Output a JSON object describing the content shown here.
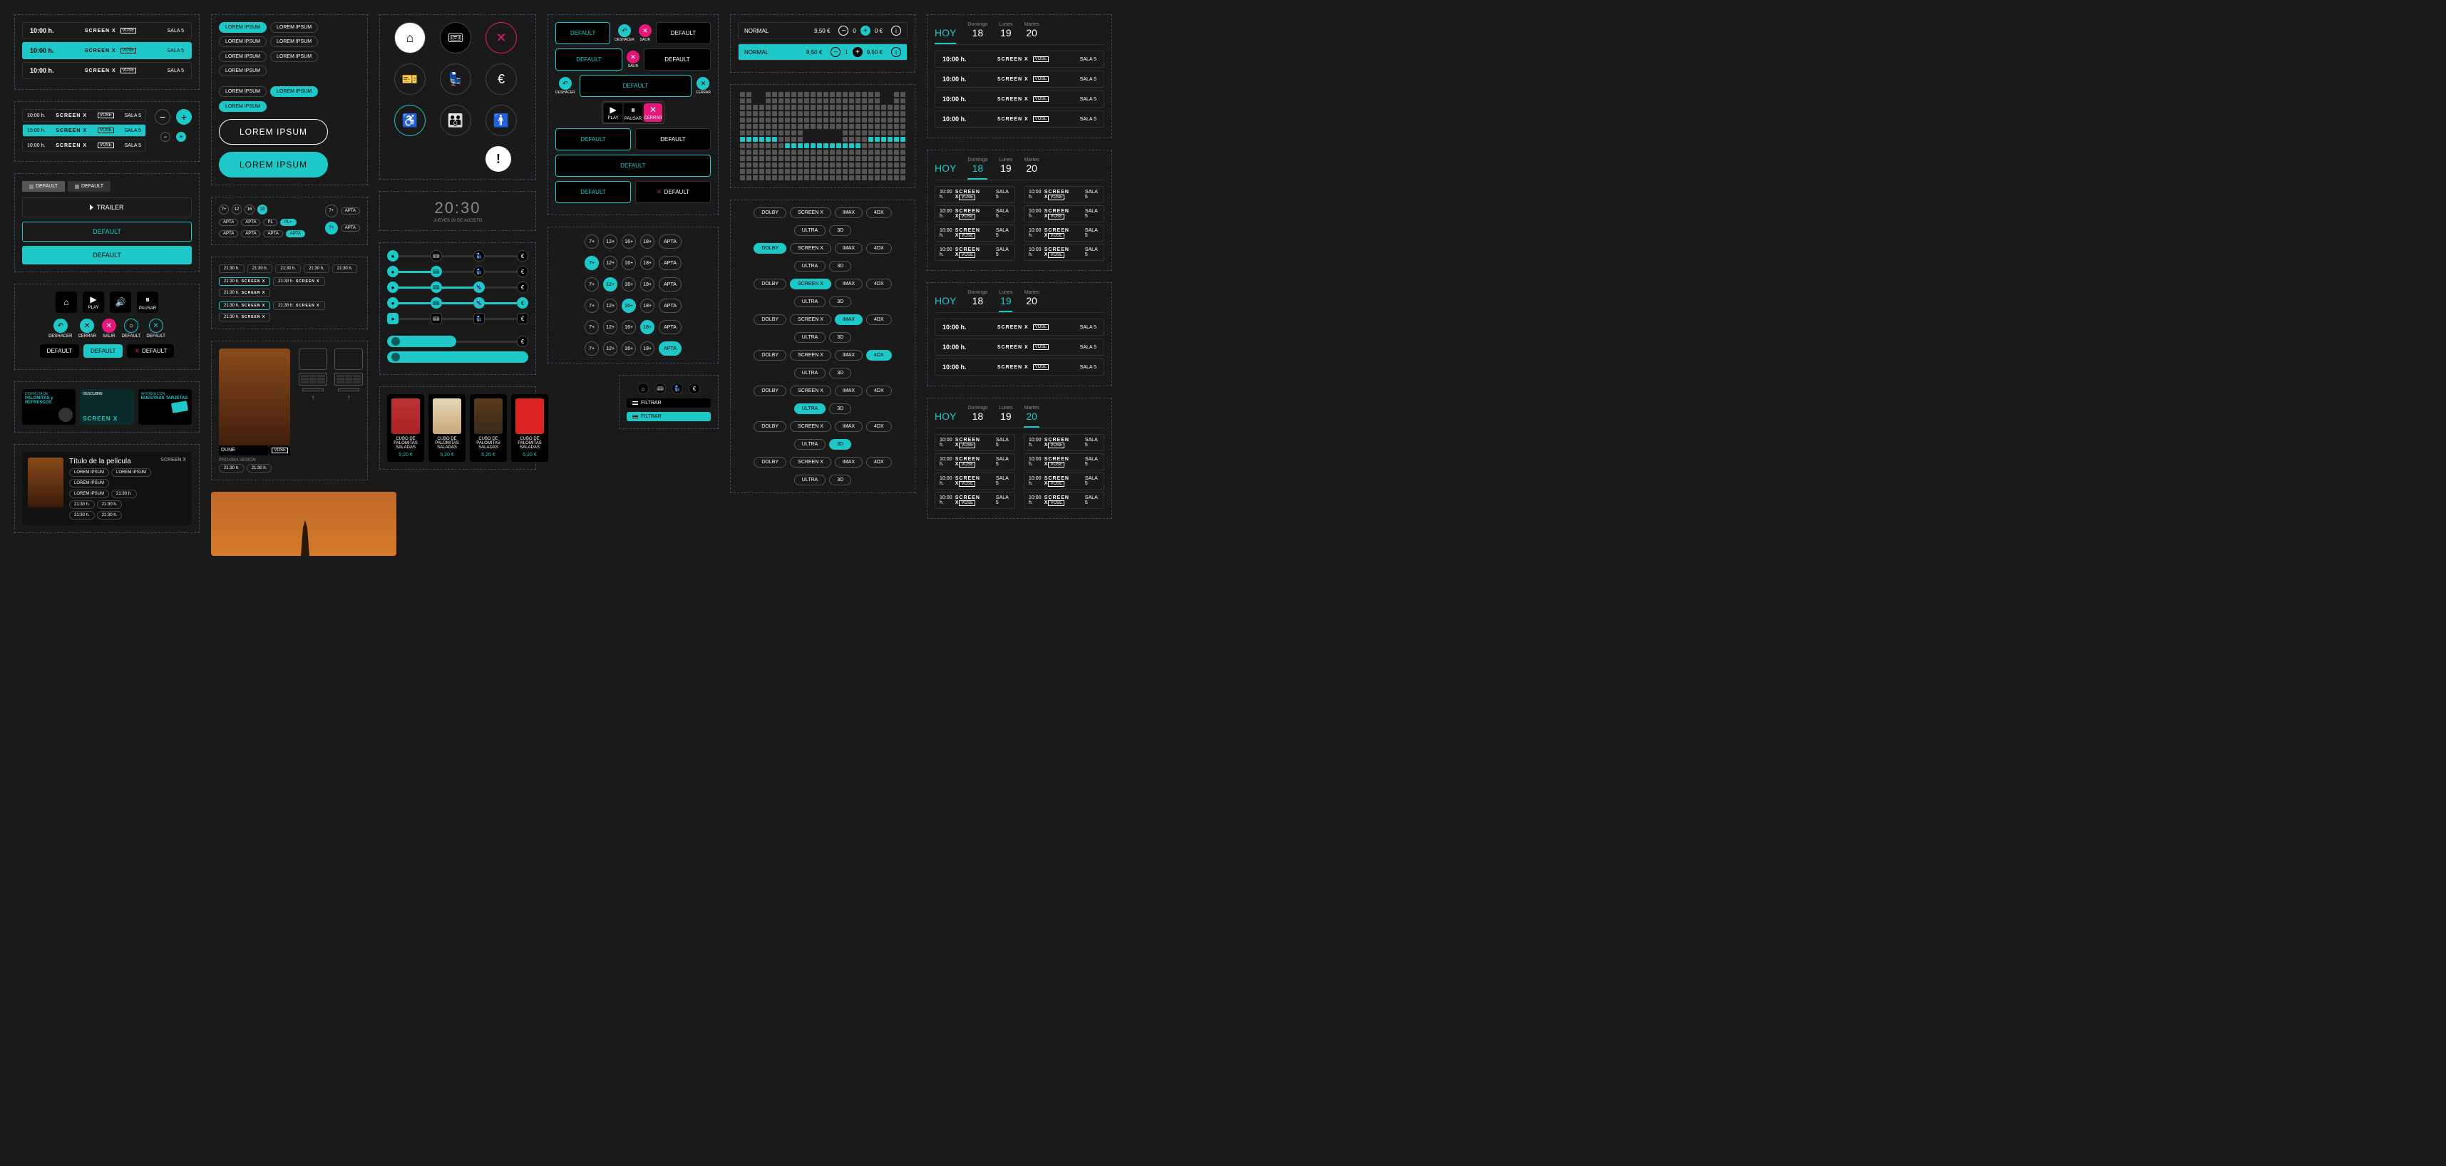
{
  "showtime": {
    "time": "10:00 h.",
    "screenx": "SCREEN X",
    "vose": "VOSE",
    "sala": "SALA 5"
  },
  "tabs": {
    "default": "DEFAULT"
  },
  "buttons": {
    "trailer": "TRAILER",
    "default": "DEFAULT",
    "play": "PLAY",
    "pausar": "PAUSAR",
    "deshacer": "DESHACER",
    "cerrar": "CERRAR",
    "salir": "SALIR"
  },
  "lorem": {
    "chip": "LOREM IPSUM",
    "big": "LOREM IPSUM"
  },
  "promos": {
    "p1a": "DISFRUTA DE",
    "p1b": "PALOMITAS y REFRESCOS",
    "p2a": "DESCUBRE",
    "p2b": "SCREEN X",
    "p3a": "AHORRA CON",
    "p3b": "NUESTRAS TARJETAS"
  },
  "movie": {
    "title": "Título de la película",
    "screenx": "SCREEN X",
    "proxima": "PRÓXIMA SESIÓN",
    "dune": "DUNE"
  },
  "times": {
    "t": "21:30 h."
  },
  "clock": {
    "time": "20:30",
    "date": "JUEVES 29 DE AGOSTO"
  },
  "ratings": {
    "r7": "7+",
    "r12": "12+",
    "r16": "16+",
    "r18": "18+",
    "apta": "APTA"
  },
  "prod": {
    "name": "CUBO DE PALOMITAS SALADAS",
    "price": "5,20 €"
  },
  "ticket": {
    "normal": "NORMAL",
    "price1": "9,50 €",
    "price2": "0 €",
    "qty0": "0",
    "qty1": "1"
  },
  "formats": {
    "dolby": "DOLBY",
    "screenx": "SCREEN X",
    "imax": "IMAX",
    "fourdx": "4DX",
    "ultra": "ULTRA",
    "threed": "3D"
  },
  "filter": "FILTRAR",
  "days": {
    "hoy": "HOY",
    "dom": "Domingo",
    "lun": "Lunes",
    "mar": "Martes",
    "d18": "18",
    "d19": "19",
    "d20": "20"
  }
}
